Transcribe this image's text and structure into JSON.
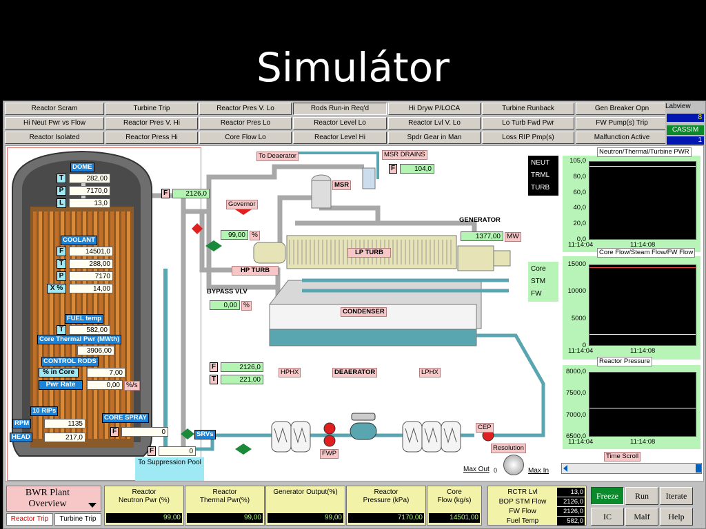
{
  "slide_title": "Simulátor",
  "annunciators": [
    [
      "Reactor Scram",
      "Turbine Trip",
      "Reactor Pres V. Lo",
      "Rods Run-in Req'd",
      "Hi Dryw P/LOCA",
      "Turbine Runback",
      "Gen Breaker Opn"
    ],
    [
      "Hi Neut Pwr vs Flow",
      "Reactor Pres V. Hi",
      "Reactor Pres Lo",
      "Reactor Level Lo",
      "Reactor Lvl V. Lo",
      "Lo Turb Fwd Pwr",
      "FW Pump(s) Trip"
    ],
    [
      "Reactor Isolated",
      "Reactor Press Hi",
      "Core Flow Lo",
      "Reactor Level Hi",
      "Spdr Gear in Man",
      "Loss RIP Pmp(s)",
      "Malfunction Active"
    ]
  ],
  "labview": {
    "label": "Labview",
    "value": "8"
  },
  "cassim": {
    "label": "CASSIM",
    "value": "1"
  },
  "reactor": {
    "dome_label": "DOME",
    "dome_T": "282,00",
    "dome_P": "7170,0",
    "dome_L": "13,0",
    "coolant_label": "COOLANT",
    "cool_F": "14501,0",
    "cool_T": "288,00",
    "cool_P": "7170",
    "xpct_label": "X %",
    "xpct": "14,00",
    "fuel_label": "FUEL temp",
    "fuel_T": "582,00",
    "ctp_label": "Core Thermal Pwr (MWth)",
    "ctp": "3906,00",
    "rods_label": "CONTROL RODS",
    "pct_core_label": "% in Core",
    "pct_core": "7,00",
    "pwr_rate_label": "Pwr Rate",
    "pwr_rate": "0,00",
    "pwr_rate_unit": "%/s",
    "rips_label": "10 RIPs",
    "rpm_label": "RPM",
    "rpm": "1135",
    "head_label": "HEAD",
    "head": "217,0",
    "core_spray_label": "CORE SPRAY",
    "core_spray_F": "0",
    "srvs_label": "SRVs",
    "srvs_F": "0",
    "suppression_label": "To Suppression Pool",
    "main_F": "2126,0"
  },
  "letters": {
    "T": "T",
    "P": "P",
    "L": "L",
    "F": "F"
  },
  "plant": {
    "deaerator_top": "To Deaerator",
    "msr_drains": "MSR DRAINS",
    "msr_F": "104,0",
    "msr": "MSR",
    "governor": "Governor",
    "gov_val": "99,00",
    "pct": "%",
    "hp_turb": "HP TURB",
    "lp_turb": "LP TURB",
    "generator": "GENERATOR",
    "gen_val": "1377,00",
    "gen_unit": "MW",
    "bypass": "BYPASS VLV",
    "bypass_val": "0,00",
    "condenser": "CONDENSER",
    "fw_F": "2126,0",
    "fw_T": "221,00",
    "hphx": "HPHX",
    "deaerator": "DEAERATOR",
    "lphx": "LPHX",
    "fwp": "FWP",
    "cep": "CEP",
    "resolution": "Resolution",
    "max_out": "Max Out",
    "max_in": "Max In",
    "zero": "0",
    "time_scroll": "Time Scroll"
  },
  "charts": [
    {
      "title": "Neutron/Thermal/Turbine PWR",
      "legend": [
        "NEUT",
        "TRML",
        "TURB"
      ],
      "yticks": [
        "105,0",
        "80,0",
        "60,0",
        "40,0",
        "20,0",
        "0,0"
      ],
      "xticks": [
        "11:14:04",
        "11:14:08"
      ]
    },
    {
      "title": "Core Flow/Steam Flow/FW Flow",
      "legend": [
        "Core",
        "STM",
        "FW"
      ],
      "yticks": [
        "15000",
        "10000",
        "5000",
        "0"
      ],
      "xticks": [
        "11:14:04",
        "11:14:08"
      ]
    },
    {
      "title": "Reactor Pressure",
      "legend": [],
      "yticks": [
        "8000,0",
        "7500,0",
        "7000,0",
        "6500,0"
      ],
      "xticks": [
        "11:14:04",
        "11:14:08"
      ]
    }
  ],
  "chart_data": [
    {
      "type": "line",
      "title": "Neutron/Thermal/Turbine PWR",
      "ylim": [
        0,
        105
      ],
      "series": [
        {
          "name": "NEUT",
          "values": [
            99,
            99
          ]
        },
        {
          "name": "TRML",
          "values": [
            99,
            99
          ]
        },
        {
          "name": "TURB",
          "values": [
            99,
            99
          ]
        }
      ],
      "x": [
        "11:14:04",
        "11:14:08"
      ]
    },
    {
      "type": "line",
      "title": "Core Flow/Steam Flow/FW Flow",
      "ylim": [
        0,
        15000
      ],
      "series": [
        {
          "name": "Core",
          "values": [
            14501,
            14501
          ]
        },
        {
          "name": "STM",
          "values": [
            2126,
            2126
          ]
        },
        {
          "name": "FW",
          "values": [
            2126,
            2126
          ]
        }
      ],
      "x": [
        "11:14:04",
        "11:14:08"
      ]
    },
    {
      "type": "line",
      "title": "Reactor Pressure",
      "ylim": [
        6500,
        8000
      ],
      "series": [
        {
          "values": [
            7170,
            7170
          ]
        }
      ],
      "x": [
        "11:14:04",
        "11:14:08"
      ]
    }
  ],
  "bottom": {
    "overview": "BWR Plant Overview",
    "reactor_trip": "Reactor Trip",
    "turbine_trip": "Turbine Trip",
    "cols": [
      {
        "h": "Reactor\nNeutron Pwr (%)",
        "v": "99,00"
      },
      {
        "h": "Reactor\nThermal Pwr(%)",
        "v": "99,00"
      },
      {
        "h": "Generator Output(%)",
        "v": "99,00"
      },
      {
        "h": "Reactor\nPressure (kPa)",
        "v": "7170,00"
      },
      {
        "h": "Core\nFlow (kg/s)",
        "v": "14501,00"
      }
    ],
    "summary": [
      [
        "RCTR Lvl",
        "13,0"
      ],
      [
        "BOP STM Flow",
        "2126,0"
      ],
      [
        "FW Flow",
        "2126,0"
      ],
      [
        "Fuel Temp",
        "582,0"
      ]
    ],
    "buttons": [
      "Freeze",
      "Run",
      "Iterate",
      "IC",
      "Malf",
      "Help"
    ]
  }
}
